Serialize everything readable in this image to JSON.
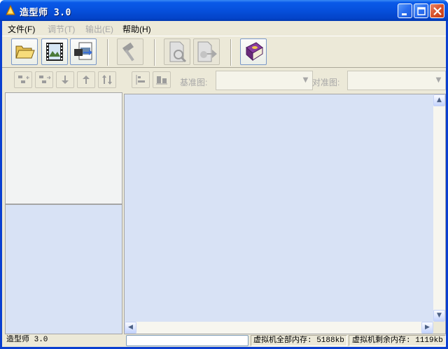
{
  "window": {
    "title": "造型师 3.0",
    "controls": {
      "minimize": "minimize",
      "maximize": "maximize",
      "close": "close"
    }
  },
  "menu": [
    {
      "label": "文件(F)",
      "enabled": true
    },
    {
      "label": "调节(T)",
      "enabled": false
    },
    {
      "label": "输出(E)",
      "enabled": false
    },
    {
      "label": "帮助(H)",
      "enabled": true
    }
  ],
  "toolbar": {
    "buttons": [
      {
        "icon": "open-folder-icon",
        "enabled": true
      },
      {
        "icon": "image-film-icon",
        "enabled": true
      },
      {
        "icon": "image-convert-icon",
        "enabled": true
      },
      {
        "icon": "hammer-icon",
        "enabled": false
      },
      {
        "icon": "document-search-icon",
        "enabled": false
      },
      {
        "icon": "document-export-icon",
        "enabled": false
      },
      {
        "icon": "help-book-icon",
        "enabled": true
      }
    ]
  },
  "left_toolbar": {
    "buttons": [
      {
        "icon": "tree-outdent-icon"
      },
      {
        "icon": "tree-indent-icon"
      },
      {
        "icon": "arrow-down-icon"
      },
      {
        "icon": "arrow-up-icon"
      },
      {
        "icon": "swap-vertical-icon"
      }
    ]
  },
  "right_toolbar": {
    "base_label": "基准图:",
    "align_label": "对准图:",
    "base_value": "",
    "align_value": ""
  },
  "status": {
    "app": "造型师 3.0",
    "vm_total": "虚拟机全部内存: 5188kb",
    "vm_free": "虚拟机剩余内存: 1119kb"
  },
  "colors": {
    "title_bar": "#0650dc",
    "client_bg": "#ece9d8",
    "canvas_bg": "#d8e2f5",
    "disabled_text": "#a7a7a7"
  }
}
